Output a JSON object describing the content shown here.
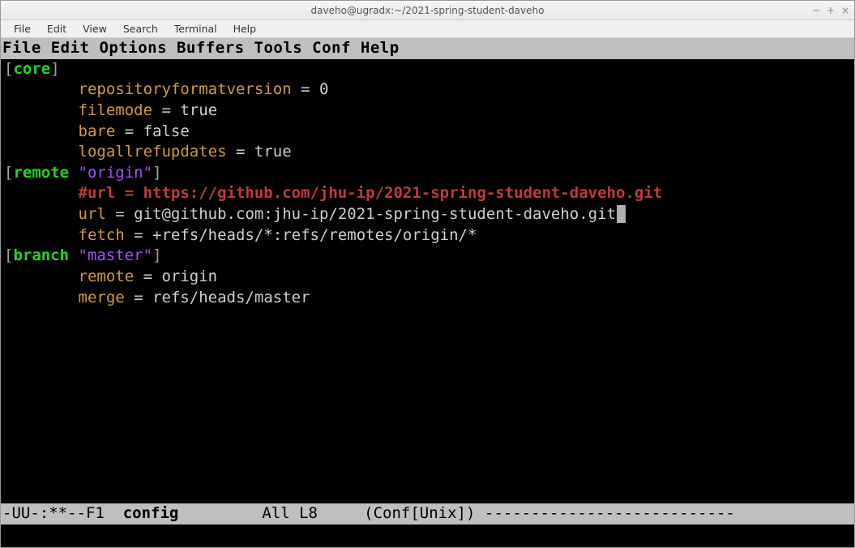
{
  "window": {
    "title": "daveho@ugradx:~/2021-spring-student-daveho",
    "controls": {
      "minimize": "−",
      "maximize": "+",
      "close": "×"
    }
  },
  "os_menu": {
    "file": "File",
    "edit": "Edit",
    "view": "View",
    "search": "Search",
    "terminal": "Terminal",
    "help": "Help"
  },
  "emacs_menu": {
    "file": "File",
    "edit": "Edit",
    "options": "Options",
    "buffers": "Buffers",
    "tools": "Tools",
    "conf": "Conf",
    "help": "Help"
  },
  "config": {
    "sections": {
      "core": {
        "name": "core",
        "entries": {
          "k1": "repositoryformatversion",
          "v1": "0",
          "k2": "filemode",
          "v2": "true",
          "k3": "bare",
          "v3": "false",
          "k4": "logallrefupdates",
          "v4": "true"
        }
      },
      "remote": {
        "name": "remote",
        "sub": "\"origin\"",
        "comment": "#url = https://github.com/jhu-ip/2021-spring-student-daveho.git",
        "k1": "url",
        "v1": "git@github.com:jhu-ip/2021-spring-student-daveho.git",
        "k2": "fetch",
        "v2": "+refs/heads/*:refs/remotes/origin/*"
      },
      "branch": {
        "name": "branch",
        "sub": "\"master\"",
        "k1": "remote",
        "v1": "origin",
        "k2": "merge",
        "v2": "refs/heads/master"
      }
    }
  },
  "modeline": {
    "left": "-UU-:**--",
    "frame": "F1",
    "buffer": "config",
    "pos": "All L8",
    "mode": "(Conf[Unix])",
    "dashes": "---------------------------"
  }
}
